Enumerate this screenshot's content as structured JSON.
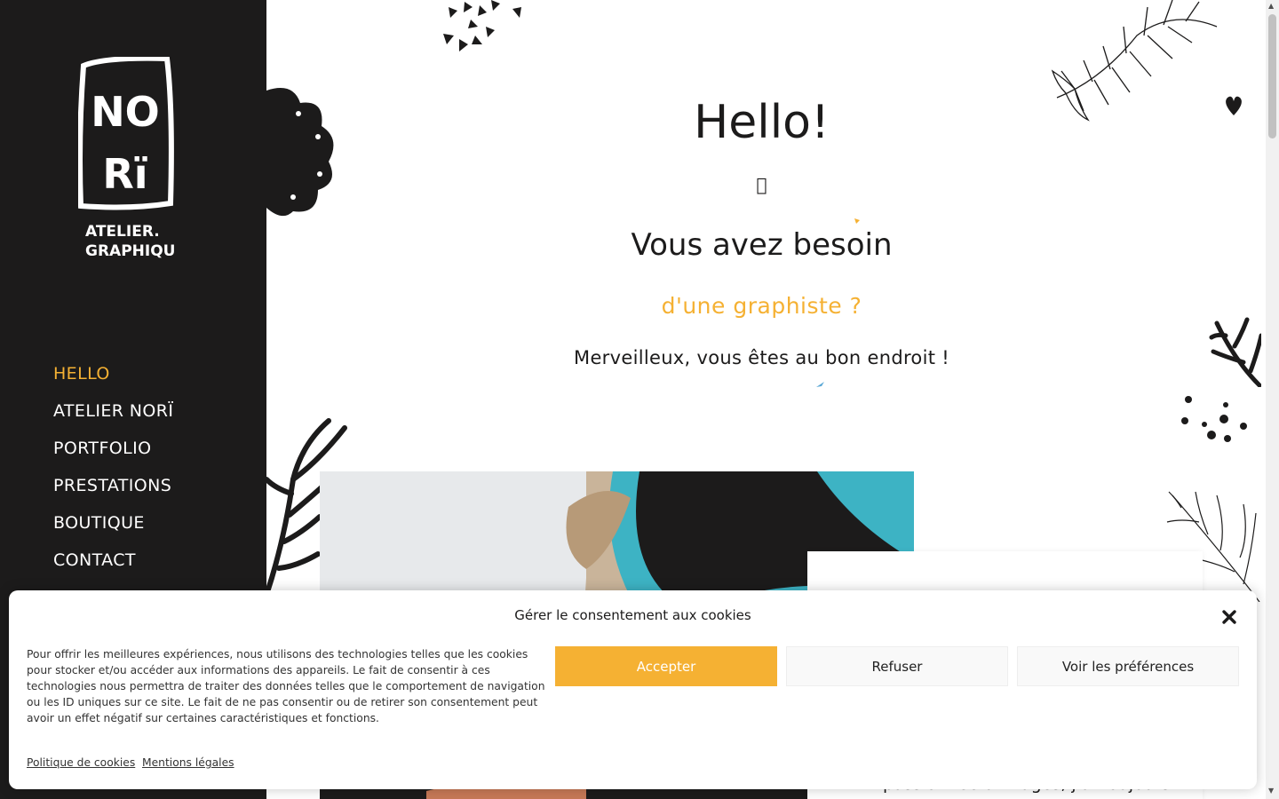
{
  "colors": {
    "accent": "#f5b133",
    "sidebar_bg": "#1c1b1b",
    "text": "#1c1b1b",
    "white": "#ffffff"
  },
  "logo": {
    "line1": "NO",
    "line2": "Rï",
    "line3": "ATELIER.",
    "line4": "GRAPHIQUE"
  },
  "nav": {
    "items": [
      {
        "label": "HELLO",
        "active": true
      },
      {
        "label": "ATELIER NORÏ"
      },
      {
        "label": "PORTFOLIO"
      },
      {
        "label": "PRESTATIONS"
      },
      {
        "label": "BOUTIQUE"
      },
      {
        "label": "CONTACT"
      }
    ]
  },
  "hero": {
    "title": "Hello!",
    "icon": "",
    "subtitle": "Vous avez besoin",
    "accent_line": "d'une graphiste ?",
    "tagline": "Merveilleux, vous êtes au bon endroit !"
  },
  "about": {
    "peek_text": "passionnée d'images, j'ai toujours"
  },
  "cookie": {
    "title": "Gérer le consentement aux cookies",
    "text": "Pour offrir les meilleures expériences, nous utilisons des technologies telles que les cookies pour stocker et/ou accéder aux informations des appareils. Le fait de consentir à ces technologies nous permettra de traiter des données telles que le comportement de navigation ou les ID uniques sur ce site. Le fait de ne pas consentir ou de retirer son consentement peut avoir un effet négatif sur certaines caractéristiques et fonctions.",
    "accept": "Accepter",
    "refuse": "Refuser",
    "preferences": "Voir les préférences",
    "link_cookies": "Politique de cookies",
    "link_legal": "Mentions légales"
  },
  "icons": [
    "close-icon",
    "flower-icon",
    "coral-icon",
    "heart-icon",
    "dots-icon",
    "leaf-icon",
    "scroll-arrow-up-icon",
    "scroll-arrow-down-icon"
  ]
}
